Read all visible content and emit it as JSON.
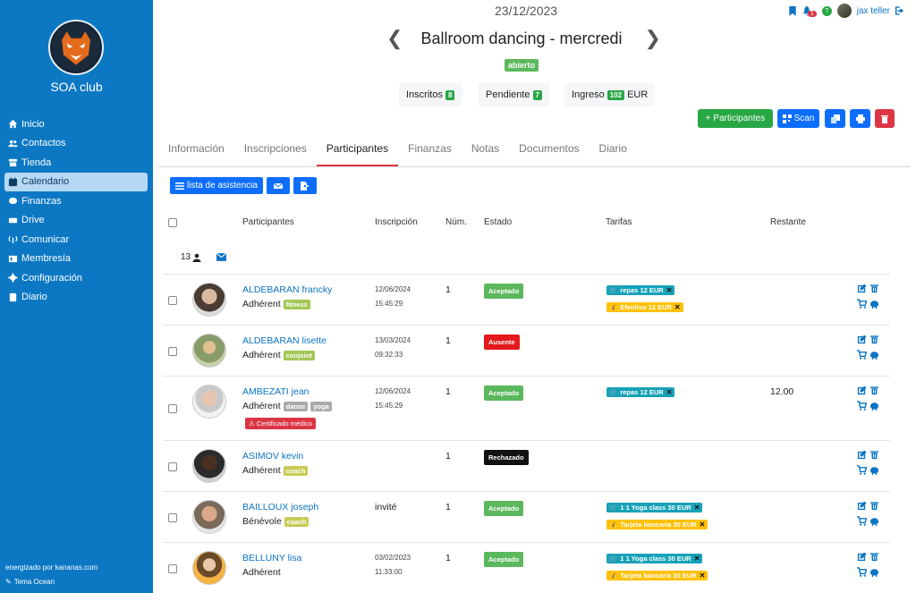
{
  "sidebar": {
    "club_name": "SOA club",
    "items": [
      {
        "label": "Inicio",
        "icon": "home-icon"
      },
      {
        "label": "Contactos",
        "icon": "users-icon"
      },
      {
        "label": "Tienda",
        "icon": "store-icon"
      },
      {
        "label": "Calendario",
        "icon": "calendar-icon",
        "active": true
      },
      {
        "label": "Finanzas",
        "icon": "finance-icon"
      },
      {
        "label": "Drive",
        "icon": "drive-icon"
      },
      {
        "label": "Comunicar",
        "icon": "broadcast-icon"
      },
      {
        "label": "Membresía",
        "icon": "membership-icon"
      },
      {
        "label": "Configuración",
        "icon": "gear-icon"
      },
      {
        "label": "Diario",
        "icon": "book-icon"
      }
    ],
    "powered_by": "energizado por kananas.com",
    "theme": "Tema Ocean"
  },
  "header": {
    "date": "23/12/2023",
    "title": "Ballroom dancing - mercredi",
    "status": "abierto",
    "notifications_count": "1",
    "help_label": "?",
    "user_name": "jax teller"
  },
  "stats": {
    "inscritos_label": "Inscritos",
    "inscritos_value": "8",
    "pendiente_label": "Pendiente",
    "pendiente_value": "7",
    "ingreso_label": "Ingreso",
    "ingreso_value": "102",
    "ingreso_currency": "EUR"
  },
  "actions": {
    "add_participants": "+ Participantes",
    "scan": "Scan"
  },
  "tabs": [
    "Información",
    "Inscripciones",
    "Participantes",
    "Finanzas",
    "Notas",
    "Documentos",
    "Diario"
  ],
  "active_tab": "Participantes",
  "toolbar": {
    "attendance_list": "lista de asistencia"
  },
  "table": {
    "headers": {
      "participants": "Participantes",
      "inscription": "Inscripción",
      "num": "Núm.",
      "state": "Estado",
      "rates": "Tarifas",
      "remaining": "Restante"
    },
    "participant_count": "13",
    "rows": [
      {
        "name": "ALDEBARAN francky",
        "type": "Adhérent",
        "tags": [
          "fitness"
        ],
        "date": "12/06/2024",
        "time": "15:45:29",
        "num": "1",
        "state": "Aceptado",
        "rates": [
          {
            "label": "repas 12 EUR",
            "kind": "cart"
          },
          {
            "label": "Efectivo 12 EUR",
            "kind": "cash"
          }
        ],
        "remaining": ""
      },
      {
        "name": "ALDEBARAN lisette",
        "type": "Adhérent",
        "tags": [
          "conjoint"
        ],
        "date": "13/03/2024",
        "time": "09:32:33",
        "num": "1",
        "state": "Ausente",
        "rates": [],
        "remaining": ""
      },
      {
        "name": "AMBEZATI jean",
        "type": "Adhérent",
        "tags": [
          "danse",
          "yoga"
        ],
        "certificate": "Certificado médico",
        "date": "12/06/2024",
        "time": "15:45:29",
        "num": "1",
        "state": "Aceptado",
        "rates": [
          {
            "label": "repas 12 EUR",
            "kind": "cart"
          }
        ],
        "remaining": "12.00"
      },
      {
        "name": "ASIMOV kevin",
        "type": "Adhérent",
        "tags": [
          "coach"
        ],
        "date": "",
        "time": "",
        "num": "1",
        "state": "Rechazado",
        "rates": [],
        "remaining": ""
      },
      {
        "name": "BAILLOUX joseph",
        "type": "Bénévole",
        "tags": [
          "coach"
        ],
        "inscription_text": "invité",
        "num": "1",
        "state": "Aceptado",
        "rates": [
          {
            "label": "1 1 Yoga class 30 EUR",
            "kind": "cart"
          },
          {
            "label": "Tarjeta bancaria 30 EUR",
            "kind": "cash"
          }
        ],
        "remaining": ""
      },
      {
        "name": "BELLUNY lisa",
        "type": "Adhérent",
        "tags": [],
        "date": "03/02/2023",
        "time": "11:33:00",
        "num": "1",
        "state": "Aceptado",
        "rates": [
          {
            "label": "1 1 Yoga class 30 EUR",
            "kind": "cart"
          },
          {
            "label": "Tarjeta bancaria 30 EUR",
            "kind": "cash"
          }
        ],
        "remaining": ""
      }
    ]
  },
  "colors": {
    "sidebar_bg": "#0c78c4",
    "accent_blue": "#0d6efd",
    "green": "#28a745",
    "red": "#dc3545",
    "teal": "#17a2b8",
    "yellow": "#ffc107"
  }
}
